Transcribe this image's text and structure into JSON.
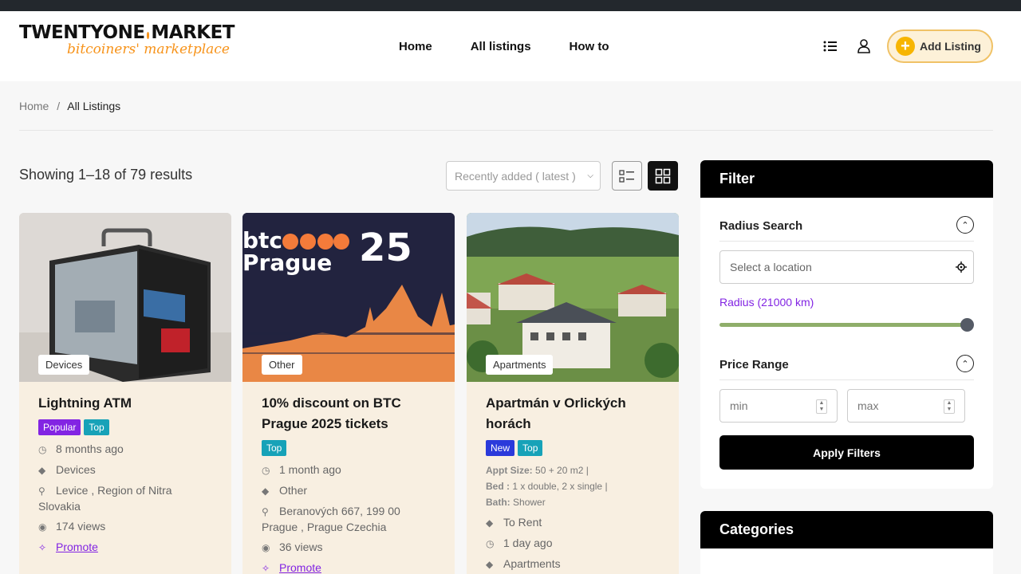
{
  "header": {
    "logo_main_left": "TWENTYONE",
    "logo_main_right": "MARKET",
    "logo_sub": "bitcoiners' marketplace",
    "nav": [
      "Home",
      "All listings",
      "How to"
    ],
    "add_listing": "Add Listing"
  },
  "breadcrumb": {
    "home": "Home",
    "separator": "/",
    "current": "All Listings"
  },
  "results": {
    "summary": "Showing 1–18 of 79 results",
    "sort_placeholder": "Recently added ( latest )"
  },
  "listings": [
    {
      "category": "Devices",
      "title": "Lightning ATM",
      "badges": [
        "Popular",
        "Top"
      ],
      "time": "8 months ago",
      "category_meta": "Devices",
      "location": "Levice , Region of Nitra Slovakia",
      "views": "174 views",
      "promote": "Promote"
    },
    {
      "category": "Other",
      "title": "10% discount on BTC Prague 2025 tickets",
      "image_text_1": "btc",
      "image_text_2": "Prague",
      "image_text_3": "25",
      "badges": [
        "Top"
      ],
      "time": "1 month ago",
      "category_meta": "Other",
      "location": "Beranových 667, 199 00 Prague , Prague Czechia",
      "views": "36 views",
      "promote": "Promote"
    },
    {
      "category": "Apartments",
      "title": "Apartmán v Orlických horách",
      "badges": [
        "New",
        "Top"
      ],
      "appt_size_label": "Appt Size:",
      "appt_size": "50 + 20 m2",
      "bed_label": "Bed :",
      "bed": "1 x double, 2 x single",
      "bath_label": "Bath:",
      "bath": "Shower",
      "sep": "|",
      "deal": "To Rent",
      "time": "1 day ago",
      "category_meta": "Apartments"
    }
  ],
  "filter": {
    "title": "Filter",
    "radius_title": "Radius Search",
    "location_placeholder": "Select a location",
    "radius_label": "Radius (21000 km)",
    "radius_fraction": 1.0,
    "price_title": "Price Range",
    "min_placeholder": "min",
    "max_placeholder": "max",
    "apply": "Apply Filters"
  },
  "categories": {
    "title": "Categories"
  },
  "colors": {
    "accent": "#f7931a",
    "purple": "#8224e3",
    "teal": "#17a2b8",
    "blue": "#2b3adb",
    "card_bg": "#f8efe1"
  }
}
